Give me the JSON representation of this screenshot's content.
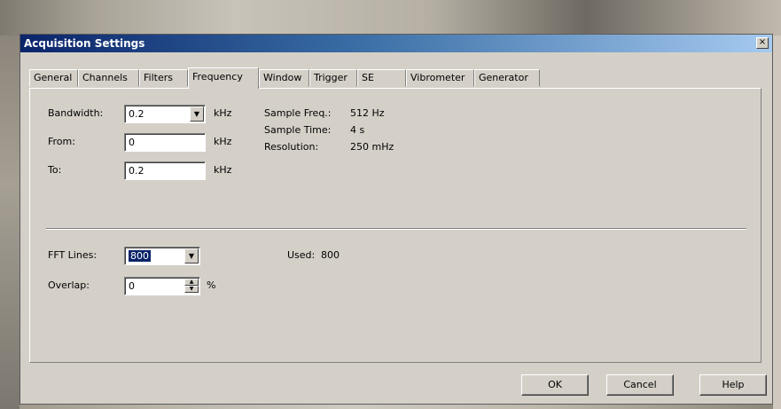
{
  "window": {
    "title": "Acquisition Settings",
    "close_glyph": "×"
  },
  "tabs": [
    {
      "label": "General"
    },
    {
      "label": "Channels"
    },
    {
      "label": "Filters"
    },
    {
      "label": "Frequency"
    },
    {
      "label": "Window"
    },
    {
      "label": "Trigger"
    },
    {
      "label": "SE"
    },
    {
      "label": "Vibrometer"
    },
    {
      "label": "Generator"
    }
  ],
  "active_tab": "Frequency",
  "frequency": {
    "bandwidth": {
      "label": "Bandwidth:",
      "value": "0.2",
      "unit": "kHz"
    },
    "from": {
      "label": "From:",
      "value": "0",
      "unit": "kHz"
    },
    "to": {
      "label": "To:",
      "value": "0.2",
      "unit": "kHz"
    },
    "info": [
      {
        "label": "Sample Freq.:",
        "value": "512 Hz"
      },
      {
        "label": "Sample Time:",
        "value": "4 s"
      },
      {
        "label": "Resolution:",
        "value": "250 mHz"
      }
    ],
    "fft_lines": {
      "label": "FFT Lines:",
      "value": "800"
    },
    "used": {
      "label": "Used:",
      "value": "800"
    },
    "overlap": {
      "label": "Overlap:",
      "value": "0",
      "unit": "%"
    }
  },
  "buttons": {
    "ok": "OK",
    "cancel": "Cancel",
    "help": "Help"
  },
  "icons": {
    "dropdown": "▼",
    "spin_up": "▲",
    "spin_down": "▼"
  }
}
